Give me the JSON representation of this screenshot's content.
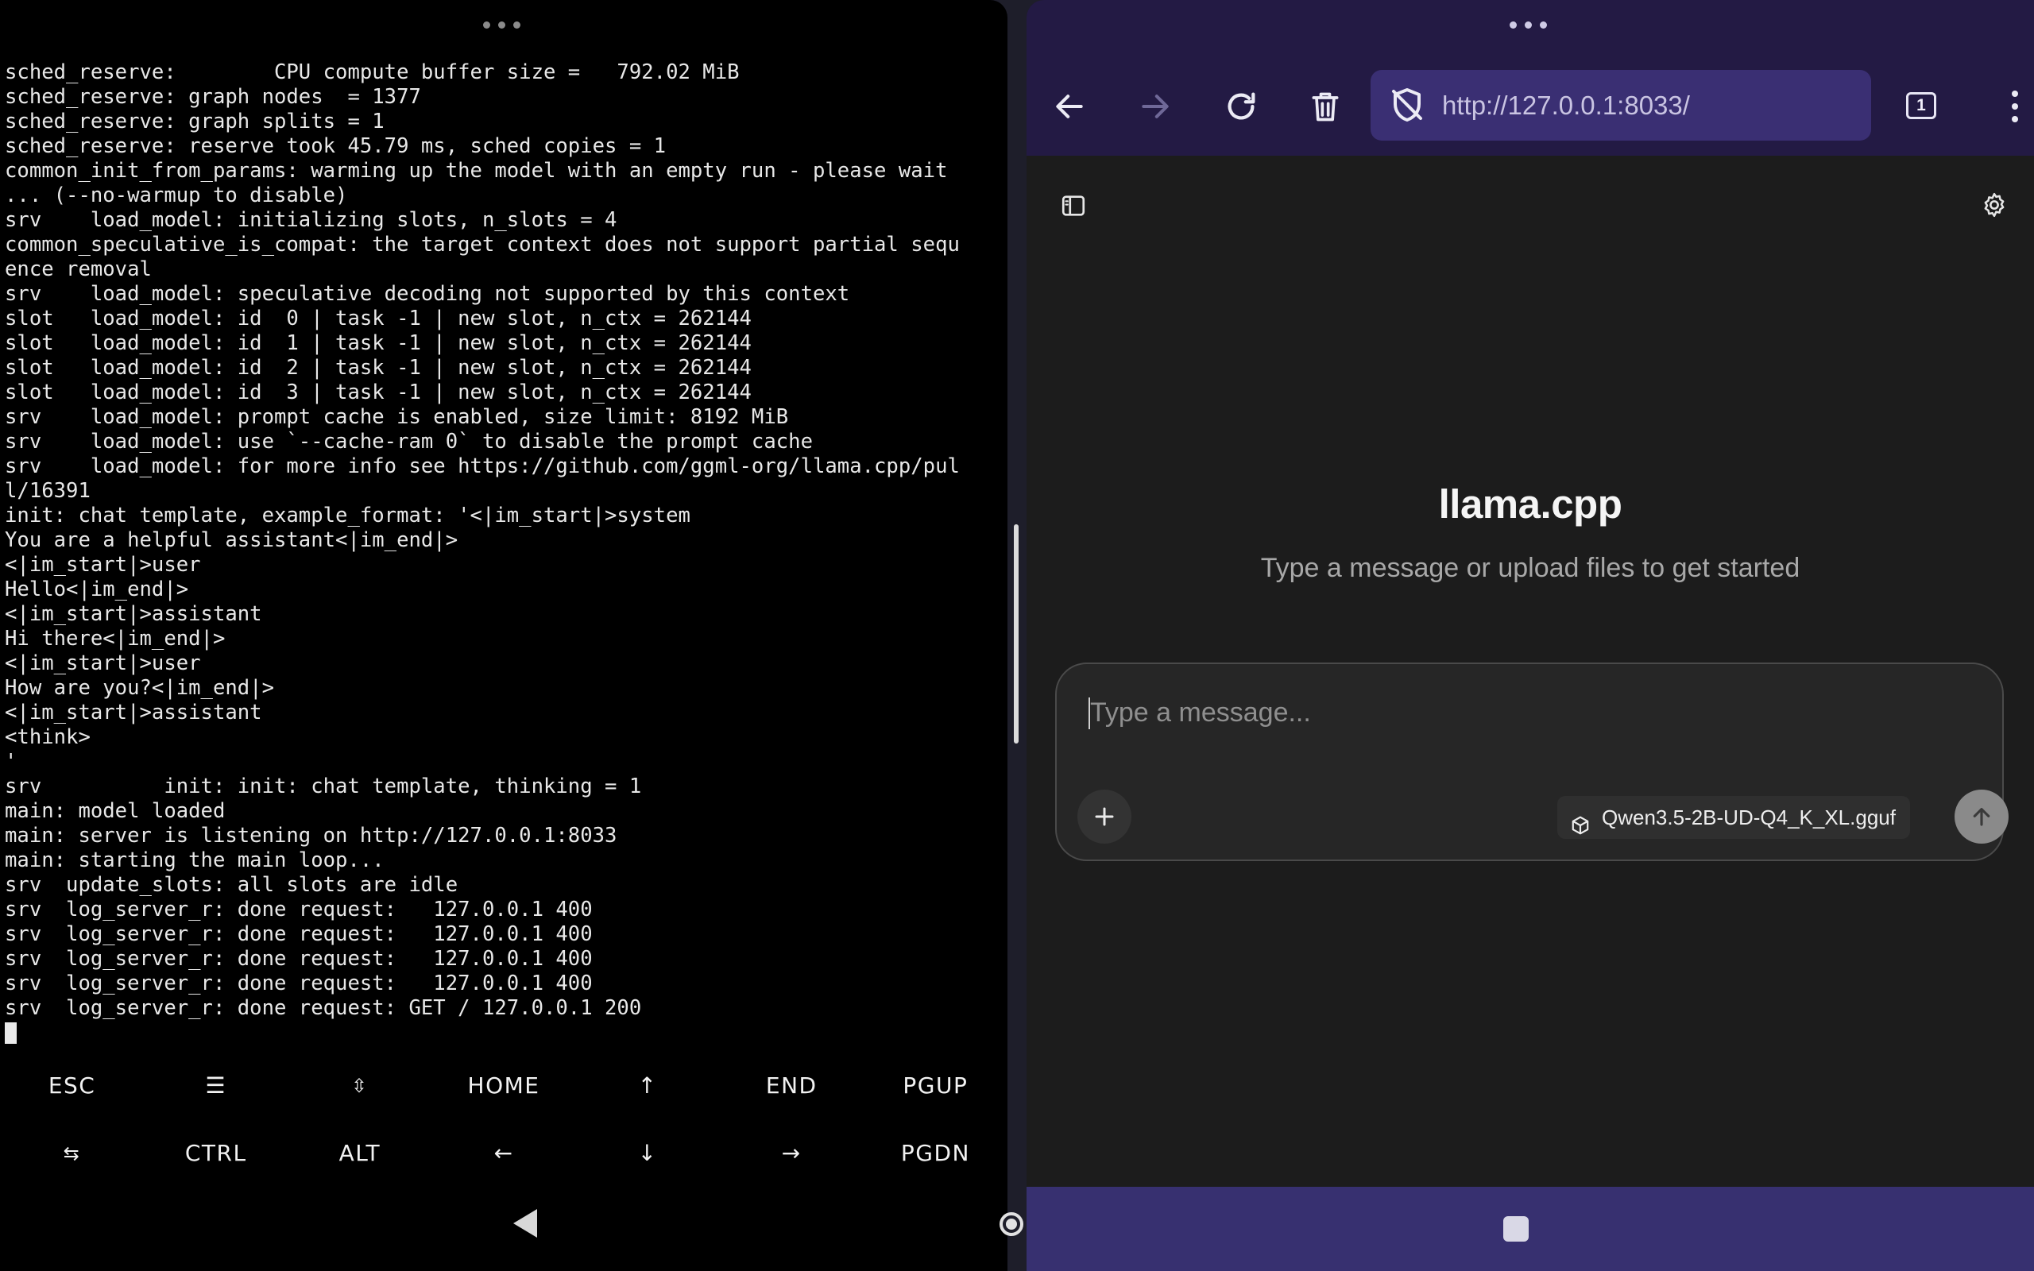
{
  "terminal": {
    "lines": [
      "sched_reserve:        CPU compute buffer size =   792.02 MiB",
      "sched_reserve: graph nodes  = 1377",
      "sched_reserve: graph splits = 1",
      "sched_reserve: reserve took 45.79 ms, sched copies = 1",
      "common_init_from_params: warming up the model with an empty run - please wait",
      "... (--no-warmup to disable)",
      "srv    load_model: initializing slots, n_slots = 4",
      "common_speculative_is_compat: the target context does not support partial sequ",
      "ence removal",
      "srv    load_model: speculative decoding not supported by this context",
      "slot   load_model: id  0 | task -1 | new slot, n_ctx = 262144",
      "slot   load_model: id  1 | task -1 | new slot, n_ctx = 262144",
      "slot   load_model: id  2 | task -1 | new slot, n_ctx = 262144",
      "slot   load_model: id  3 | task -1 | new slot, n_ctx = 262144",
      "srv    load_model: prompt cache is enabled, size limit: 8192 MiB",
      "srv    load_model: use `--cache-ram 0` to disable the prompt cache",
      "srv    load_model: for more info see https://github.com/ggml-org/llama.cpp/pul",
      "l/16391",
      "init: chat template, example_format: '<|im_start|>system",
      "You are a helpful assistant<|im_end|>",
      "<|im_start|>user",
      "Hello<|im_end|>",
      "<|im_start|>assistant",
      "Hi there<|im_end|>",
      "<|im_start|>user",
      "How are you?<|im_end|>",
      "<|im_start|>assistant",
      "<think>",
      "'",
      "srv          init: init: chat template, thinking = 1",
      "main: model loaded",
      "main: server is listening on http://127.0.0.1:8033",
      "main: starting the main loop...",
      "srv  update_slots: all slots are idle",
      "srv  log_server_r: done request:   127.0.0.1 400",
      "srv  log_server_r: done request:   127.0.0.1 400",
      "srv  log_server_r: done request:   127.0.0.1 400",
      "srv  log_server_r: done request:   127.0.0.1 400",
      "srv  log_server_r: done request: GET / 127.0.0.1 200"
    ],
    "extra_keys": {
      "row1": [
        "ESC",
        "☰",
        "⇳",
        "HOME",
        "↑",
        "END",
        "PGUP"
      ],
      "row2": [
        "⇆",
        "CTRL",
        "ALT",
        "←",
        "↓",
        "→",
        "PGDN"
      ]
    }
  },
  "browser": {
    "url": "http://127.0.0.1:8033/",
    "tab_count": "1",
    "toolbar_icons": [
      "back-arrow-icon",
      "forward-arrow-icon",
      "reload-icon",
      "delete-icon",
      "shield-off-icon",
      "tabs-icon",
      "overflow-menu-icon"
    ],
    "colors": {
      "toolbar": "#231a44",
      "url_bar": "#3a2f73",
      "nav_bar": "#373070"
    }
  },
  "app": {
    "title": "llama.cpp",
    "subtitle": "Type a message or upload files to get started",
    "input_placeholder": "Type a message...",
    "model_name": "Qwen3.5-2B-UD-Q4_K_XL.gguf",
    "icons": [
      "sidebar-toggle-icon",
      "settings-gear-icon",
      "plus-icon",
      "package-icon",
      "send-arrow-icon"
    ]
  }
}
